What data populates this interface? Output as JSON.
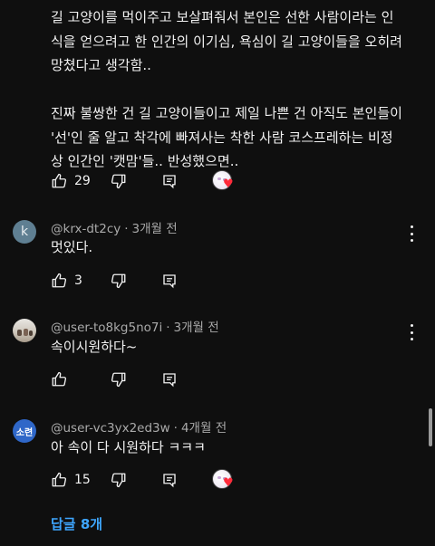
{
  "top_comment": {
    "text": "길 고양이를 먹이주고 보살펴줘서 본인은 선한 사람이라는 인\n식을 얻으려고 한 인간의 이기심, 욕심이 길 고양이들을 오히려\n망쳤다고 생각함..\n\n진짜 불쌍한 건 길 고양이들이고 제일 나쁜 건 아직도 본인들이\n'선'인 줄 알고 착각에 빠져사는 착한 사람 코스프레하는 비정\n상 인간인 '캣맘'들.. 반성했으면..",
    "likes": "29"
  },
  "comments": [
    {
      "avatar_letter": "k",
      "author": "@krx-dt2cy",
      "time": "3개월 전",
      "text": "멋있다.",
      "likes": "3"
    },
    {
      "author": "@user-to8kg5no7i",
      "time": "3개월 전",
      "text": "속이시원하다~",
      "likes": ""
    },
    {
      "avatar_letter": "소련",
      "author": "@user-vc3yx2ed3w",
      "time": "4개월 전",
      "text": "아 속이 다 시원하다 ㅋㅋㅋ",
      "likes": "15"
    }
  ],
  "replies_link": "답글 8개",
  "separator": "·",
  "colors": {
    "background": "#0f0f0f",
    "text": "#f1f1f1",
    "meta": "#aaaaaa",
    "link": "#3ea6ff",
    "heart": "#ff2b3a"
  }
}
